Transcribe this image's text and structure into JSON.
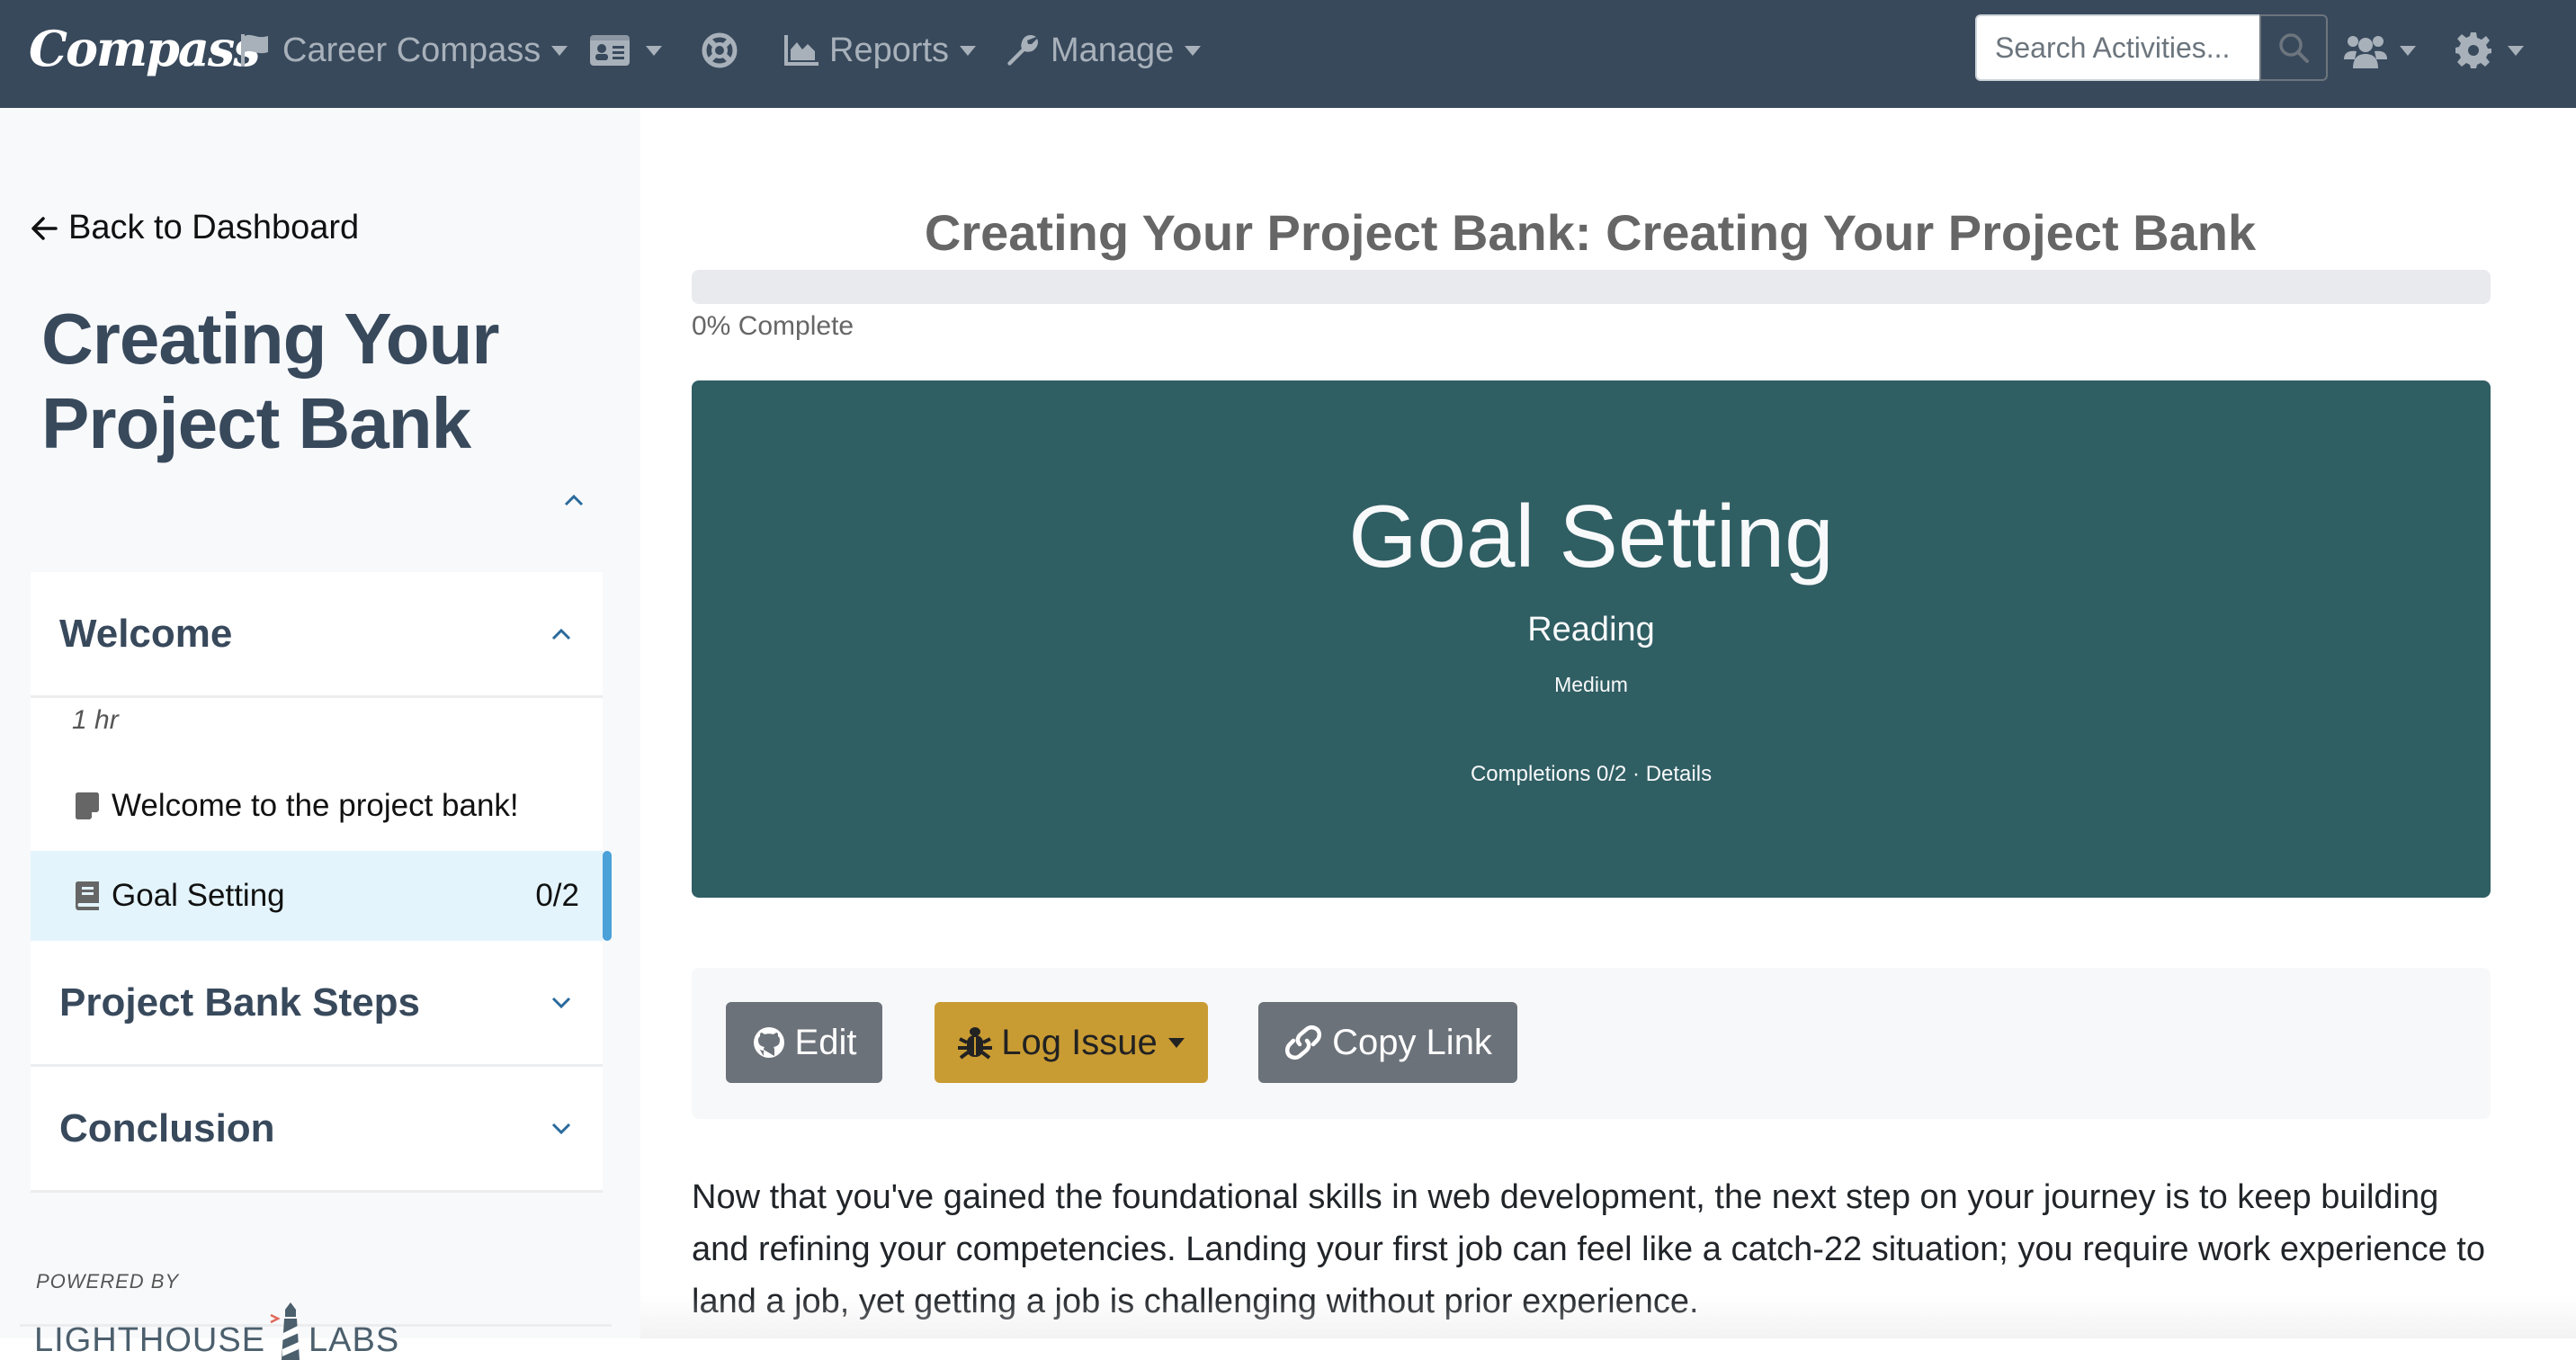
{
  "navbar": {
    "brand": "Compass",
    "items": [
      {
        "label": "Career Compass",
        "icon": "flag-icon"
      },
      {
        "label": "",
        "icon": "id-card-icon"
      },
      {
        "label": "",
        "icon": "life-ring-icon"
      },
      {
        "label": "Reports",
        "icon": "chart-area-icon"
      },
      {
        "label": "Manage",
        "icon": "wrench-icon"
      }
    ],
    "search_placeholder": "Search Activities...",
    "search_value": ""
  },
  "sidebar": {
    "back_label": "Back to Dashboard",
    "course_title": "Creating Your Project Bank",
    "sections": [
      {
        "title": "Welcome",
        "expanded": true,
        "duration": "1 hr",
        "activities": [
          {
            "label": "Welcome to the project bank!",
            "icon": "sticky-note-icon",
            "count": ""
          },
          {
            "label": "Goal Setting",
            "icon": "book-icon",
            "count": "0/2",
            "active": true
          }
        ]
      },
      {
        "title": "Project Bank Steps",
        "expanded": false
      },
      {
        "title": "Conclusion",
        "expanded": false
      }
    ],
    "powered_by": "POWERED BY",
    "partner_logo_left": "LIGHTHOUSE",
    "partner_logo_right": "LABS"
  },
  "main": {
    "title": "Creating Your Project Bank: Creating Your Project Bank",
    "progress_percent": 0,
    "progress_label": "0% Complete",
    "hero": {
      "title": "Goal Setting",
      "type": "Reading",
      "difficulty": "Medium",
      "completions": "Completions 0/2",
      "separator": " · ",
      "details_link": "Details",
      "bg_color": "#2f5e63"
    },
    "actions": {
      "edit": "Edit",
      "log_issue": "Log Issue",
      "copy_link": "Copy Link"
    },
    "body": "Now that you've gained the foundational skills in web development, the next step on your journey is to keep building and refining your competencies. Landing your first job can feel like a catch-22 situation; you require work experience to land a job, yet getting a job is challenging without prior experience."
  }
}
